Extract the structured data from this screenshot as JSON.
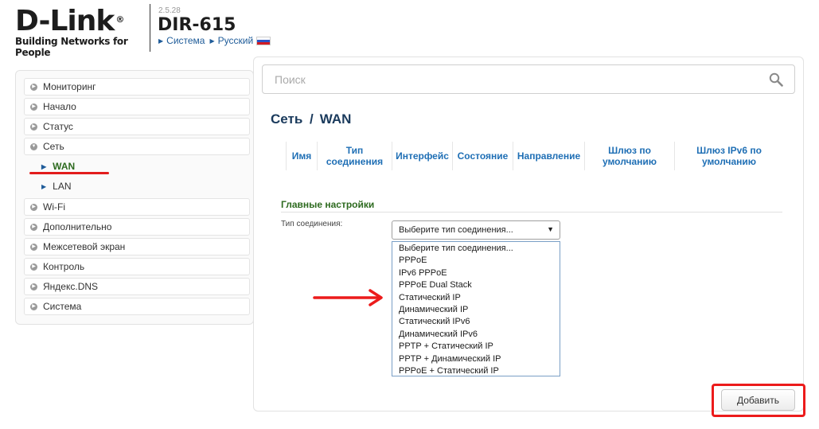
{
  "header": {
    "brand": "D-Link",
    "brand_reg": "®",
    "tagline": "Building Networks for People",
    "firmware": "2.5.28",
    "model": "DIR-615",
    "crumb_system": "Система",
    "crumb_language": "Русский"
  },
  "sidebar": {
    "items": [
      {
        "label": "Мониторинг"
      },
      {
        "label": "Начало"
      },
      {
        "label": "Статус"
      },
      {
        "label": "Сеть"
      },
      {
        "label": "WAN"
      },
      {
        "label": "LAN"
      },
      {
        "label": "Wi-Fi"
      },
      {
        "label": "Дополнительно"
      },
      {
        "label": "Межсетевой экран"
      },
      {
        "label": "Контроль"
      },
      {
        "label": "Яндекс.DNS"
      },
      {
        "label": "Система"
      }
    ]
  },
  "main": {
    "search_placeholder": "Поиск",
    "title_section": "Сеть",
    "title_page": "WAN",
    "table_headers": [
      "Имя",
      "Тип соединения",
      "Интерфейс",
      "Состояние",
      "Направление",
      "Шлюз по умолчанию",
      "Шлюз IPv6 по умолчанию"
    ],
    "section_title": "Главные настройки",
    "connection_type_label": "Тип соединения:",
    "connection_type_value": "Выберите тип соединения...",
    "connection_type_options": [
      "Выберите тип соединения...",
      "PPPoE",
      "IPv6 PPPoE",
      "PPPoE Dual Stack",
      "Статический IP",
      "Динамический IP",
      "Статический IPv6",
      "Динамический IPv6",
      "PPTP + Статический IP",
      "PPTP + Динамический IP",
      "PPPoE + Статический IP"
    ],
    "add_button": "Добавить"
  },
  "colors": {
    "accent_blue": "#1f6fb5",
    "section_green": "#2d6a1f",
    "annotation_red": "#ec1b1b"
  }
}
